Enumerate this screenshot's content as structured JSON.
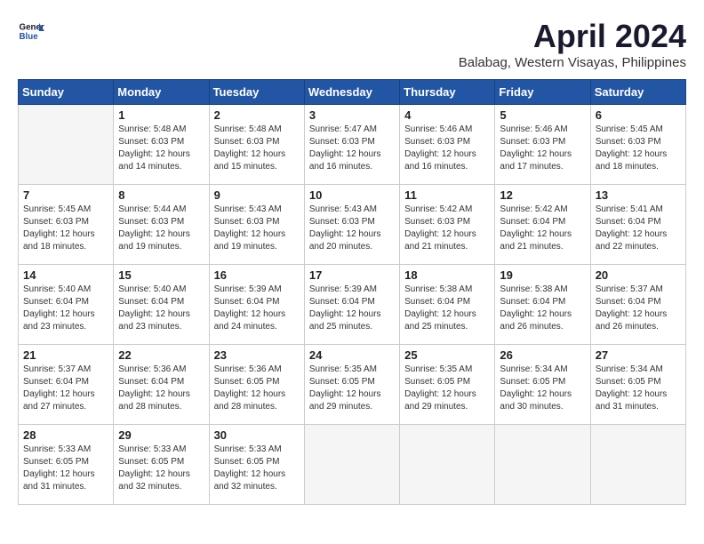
{
  "logo": {
    "line1": "General",
    "line2": "Blue"
  },
  "title": "April 2024",
  "subtitle": "Balabag, Western Visayas, Philippines",
  "weekdays": [
    "Sunday",
    "Monday",
    "Tuesday",
    "Wednesday",
    "Thursday",
    "Friday",
    "Saturday"
  ],
  "weeks": [
    [
      {
        "day": "",
        "info": ""
      },
      {
        "day": "1",
        "info": "Sunrise: 5:48 AM\nSunset: 6:03 PM\nDaylight: 12 hours\nand 14 minutes."
      },
      {
        "day": "2",
        "info": "Sunrise: 5:48 AM\nSunset: 6:03 PM\nDaylight: 12 hours\nand 15 minutes."
      },
      {
        "day": "3",
        "info": "Sunrise: 5:47 AM\nSunset: 6:03 PM\nDaylight: 12 hours\nand 16 minutes."
      },
      {
        "day": "4",
        "info": "Sunrise: 5:46 AM\nSunset: 6:03 PM\nDaylight: 12 hours\nand 16 minutes."
      },
      {
        "day": "5",
        "info": "Sunrise: 5:46 AM\nSunset: 6:03 PM\nDaylight: 12 hours\nand 17 minutes."
      },
      {
        "day": "6",
        "info": "Sunrise: 5:45 AM\nSunset: 6:03 PM\nDaylight: 12 hours\nand 18 minutes."
      }
    ],
    [
      {
        "day": "7",
        "info": "Sunrise: 5:45 AM\nSunset: 6:03 PM\nDaylight: 12 hours\nand 18 minutes."
      },
      {
        "day": "8",
        "info": "Sunrise: 5:44 AM\nSunset: 6:03 PM\nDaylight: 12 hours\nand 19 minutes."
      },
      {
        "day": "9",
        "info": "Sunrise: 5:43 AM\nSunset: 6:03 PM\nDaylight: 12 hours\nand 19 minutes."
      },
      {
        "day": "10",
        "info": "Sunrise: 5:43 AM\nSunset: 6:03 PM\nDaylight: 12 hours\nand 20 minutes."
      },
      {
        "day": "11",
        "info": "Sunrise: 5:42 AM\nSunset: 6:03 PM\nDaylight: 12 hours\nand 21 minutes."
      },
      {
        "day": "12",
        "info": "Sunrise: 5:42 AM\nSunset: 6:04 PM\nDaylight: 12 hours\nand 21 minutes."
      },
      {
        "day": "13",
        "info": "Sunrise: 5:41 AM\nSunset: 6:04 PM\nDaylight: 12 hours\nand 22 minutes."
      }
    ],
    [
      {
        "day": "14",
        "info": "Sunrise: 5:40 AM\nSunset: 6:04 PM\nDaylight: 12 hours\nand 23 minutes."
      },
      {
        "day": "15",
        "info": "Sunrise: 5:40 AM\nSunset: 6:04 PM\nDaylight: 12 hours\nand 23 minutes."
      },
      {
        "day": "16",
        "info": "Sunrise: 5:39 AM\nSunset: 6:04 PM\nDaylight: 12 hours\nand 24 minutes."
      },
      {
        "day": "17",
        "info": "Sunrise: 5:39 AM\nSunset: 6:04 PM\nDaylight: 12 hours\nand 25 minutes."
      },
      {
        "day": "18",
        "info": "Sunrise: 5:38 AM\nSunset: 6:04 PM\nDaylight: 12 hours\nand 25 minutes."
      },
      {
        "day": "19",
        "info": "Sunrise: 5:38 AM\nSunset: 6:04 PM\nDaylight: 12 hours\nand 26 minutes."
      },
      {
        "day": "20",
        "info": "Sunrise: 5:37 AM\nSunset: 6:04 PM\nDaylight: 12 hours\nand 26 minutes."
      }
    ],
    [
      {
        "day": "21",
        "info": "Sunrise: 5:37 AM\nSunset: 6:04 PM\nDaylight: 12 hours\nand 27 minutes."
      },
      {
        "day": "22",
        "info": "Sunrise: 5:36 AM\nSunset: 6:04 PM\nDaylight: 12 hours\nand 28 minutes."
      },
      {
        "day": "23",
        "info": "Sunrise: 5:36 AM\nSunset: 6:05 PM\nDaylight: 12 hours\nand 28 minutes."
      },
      {
        "day": "24",
        "info": "Sunrise: 5:35 AM\nSunset: 6:05 PM\nDaylight: 12 hours\nand 29 minutes."
      },
      {
        "day": "25",
        "info": "Sunrise: 5:35 AM\nSunset: 6:05 PM\nDaylight: 12 hours\nand 29 minutes."
      },
      {
        "day": "26",
        "info": "Sunrise: 5:34 AM\nSunset: 6:05 PM\nDaylight: 12 hours\nand 30 minutes."
      },
      {
        "day": "27",
        "info": "Sunrise: 5:34 AM\nSunset: 6:05 PM\nDaylight: 12 hours\nand 31 minutes."
      }
    ],
    [
      {
        "day": "28",
        "info": "Sunrise: 5:33 AM\nSunset: 6:05 PM\nDaylight: 12 hours\nand 31 minutes."
      },
      {
        "day": "29",
        "info": "Sunrise: 5:33 AM\nSunset: 6:05 PM\nDaylight: 12 hours\nand 32 minutes."
      },
      {
        "day": "30",
        "info": "Sunrise: 5:33 AM\nSunset: 6:05 PM\nDaylight: 12 hours\nand 32 minutes."
      },
      {
        "day": "",
        "info": ""
      },
      {
        "day": "",
        "info": ""
      },
      {
        "day": "",
        "info": ""
      },
      {
        "day": "",
        "info": ""
      }
    ]
  ]
}
